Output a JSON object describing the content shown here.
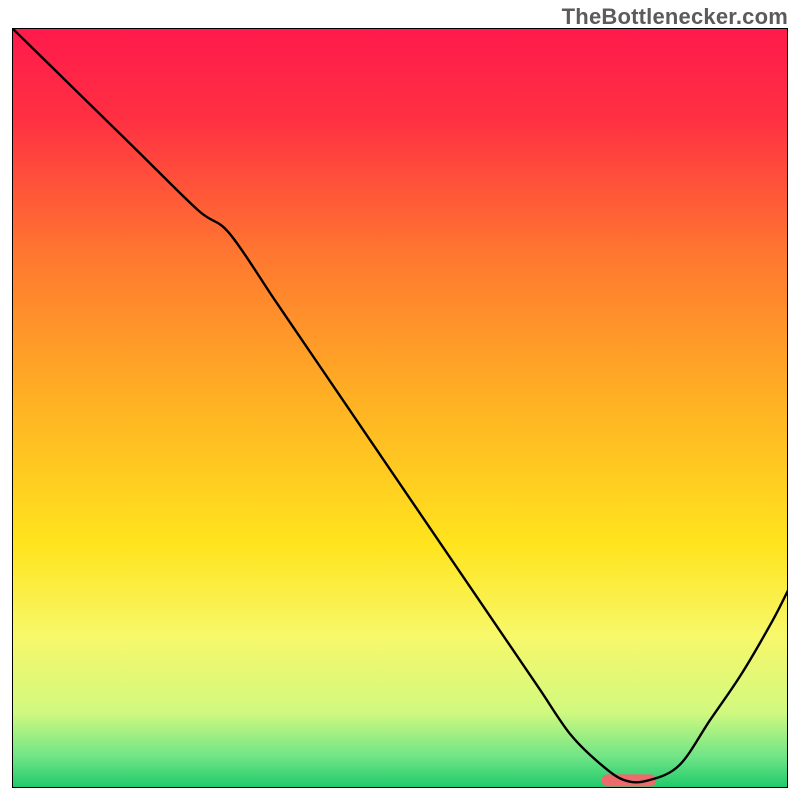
{
  "watermark": "TheBottlenecker.com",
  "chart_data": {
    "type": "line",
    "title": "",
    "xlabel": "",
    "ylabel": "",
    "xlim": [
      0,
      100
    ],
    "ylim": [
      0,
      100
    ],
    "grid": false,
    "legend": false,
    "background_gradient": {
      "stops": [
        {
          "offset": 0.0,
          "color": "#ff1a4c"
        },
        {
          "offset": 0.12,
          "color": "#ff3042"
        },
        {
          "offset": 0.3,
          "color": "#ff7830"
        },
        {
          "offset": 0.5,
          "color": "#ffb423"
        },
        {
          "offset": 0.68,
          "color": "#ffe41e"
        },
        {
          "offset": 0.8,
          "color": "#f7f86a"
        },
        {
          "offset": 0.9,
          "color": "#d1f97f"
        },
        {
          "offset": 0.96,
          "color": "#6ee486"
        },
        {
          "offset": 1.0,
          "color": "#1dc96a"
        }
      ]
    },
    "series": [
      {
        "name": "bottleneck-curve",
        "color": "#000000",
        "width": 2,
        "x": [
          0,
          8,
          16,
          24,
          28,
          34,
          40,
          46,
          52,
          58,
          64,
          68,
          72,
          76,
          79,
          82,
          86,
          90,
          94,
          98,
          100
        ],
        "y": [
          100,
          92,
          84,
          76,
          73,
          64,
          55,
          46,
          37,
          28,
          19,
          13,
          7,
          3,
          1,
          1,
          3,
          9,
          15,
          22,
          26
        ]
      }
    ],
    "marker": {
      "name": "optimal-range",
      "shape": "rounded-bar",
      "color": "#ed6a6d",
      "x_start": 76,
      "x_end": 83,
      "y": 1,
      "height": 1.6
    }
  }
}
